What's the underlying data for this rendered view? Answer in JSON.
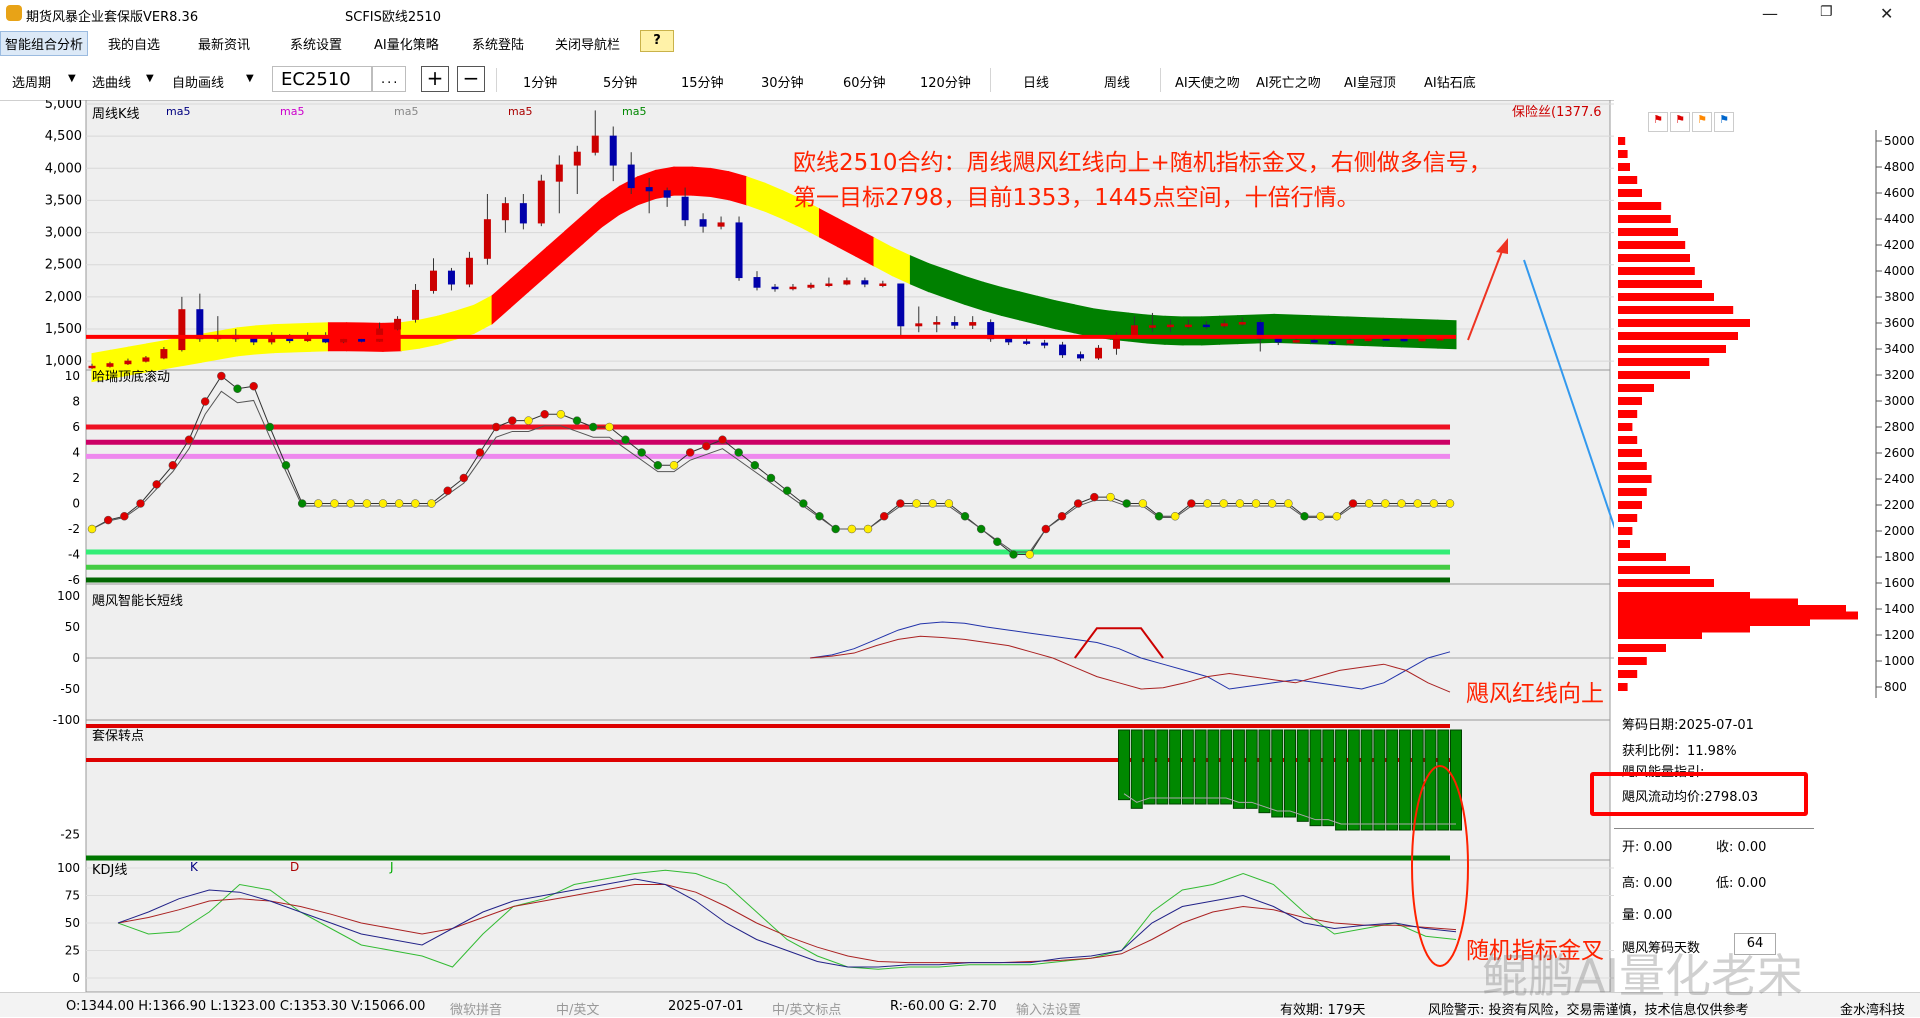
{
  "window": {
    "app_title": "期货风暴企业套保版VER8.36",
    "doc_title": "SCFIS欧线2510"
  },
  "menu": {
    "items": [
      "智能组合分析",
      "我的自选",
      "最新资讯",
      "系统设置",
      "AI量化策略",
      "系统登陆",
      "关闭导航栏"
    ],
    "help": "?"
  },
  "toolbar": {
    "period": "选周期",
    "curve": "选曲线",
    "draw": "自助画线",
    "symbol": "EC2510",
    "more": "...",
    "plus": "+",
    "minus": "−",
    "intervals": [
      "1分钟",
      "5分钟",
      "15分钟",
      "30分钟",
      "60分钟",
      "120分钟",
      "日线",
      "周线"
    ],
    "ai_buttons": [
      "AI天使之吻",
      "AI死亡之吻",
      "AI皇冠顶",
      "AI钻石底"
    ]
  },
  "panels": {
    "main_title": "周线K线",
    "ma_labels": [
      "ma5",
      "ma5",
      "ma5",
      "ma5",
      "ma5"
    ],
    "protection": "保险丝(1377.6",
    "harry_title": "哈瑞顶底滚动",
    "typhoon_title": "飓风智能长短线",
    "hedge_title": "套保转点",
    "kdj_title": "KDJ线",
    "kdj_labels": [
      "K",
      "D",
      "J"
    ]
  },
  "annotations": {
    "line1": "欧线2510合约：周线飓风红线向上+随机指标金叉，右侧做多信号，",
    "line2": "第一目标2798，目前1353，1445点空间，十倍行情。",
    "red_up": "飓风红线向上",
    "golden_cross": "随机指标金叉"
  },
  "axes": {
    "price_ticks": [
      "5,000",
      "4,500",
      "4,000",
      "3,500",
      "3,000",
      "2,500",
      "2,000",
      "1,500",
      "1,000"
    ],
    "harry_ticks": [
      "10",
      "8",
      "6",
      "4",
      "2",
      "0",
      "-2",
      "-4",
      "-6"
    ],
    "typhoon_ticks": [
      "100",
      "50",
      "0",
      "-50",
      "-100"
    ],
    "hedge_ticks": [
      "-25"
    ],
    "kdj_ticks": [
      "100",
      "75",
      "50",
      "25",
      "0"
    ],
    "profile_ticks": [
      "5000",
      "4800",
      "4600",
      "4400",
      "4200",
      "4000",
      "3800",
      "3600",
      "3400",
      "3200",
      "3000",
      "2800",
      "2600",
      "2400",
      "2200",
      "2000",
      "1800",
      "1600",
      "1400",
      "1200",
      "1000",
      "800"
    ]
  },
  "chart_data": {
    "type": "candlestick",
    "period": "周线",
    "symbol": "EC2510",
    "price_ylim": [
      800,
      5000
    ],
    "support_line": 1377.6,
    "candles": [
      {
        "o": 900,
        "c": 920,
        "h": 960,
        "l": 880
      },
      {
        "o": 920,
        "c": 960,
        "h": 990,
        "l": 900
      },
      {
        "o": 960,
        "c": 1000,
        "h": 1040,
        "l": 940
      },
      {
        "o": 1000,
        "c": 1050,
        "h": 1080,
        "l": 980
      },
      {
        "o": 1050,
        "c": 1180,
        "h": 1220,
        "l": 1030
      },
      {
        "o": 1180,
        "c": 1800,
        "h": 2000,
        "l": 1150
      },
      {
        "o": 1800,
        "c": 1350,
        "h": 2050,
        "l": 1300
      },
      {
        "o": 1350,
        "c": 1400,
        "h": 1700,
        "l": 1300
      },
      {
        "o": 1400,
        "c": 1350,
        "h": 1500,
        "l": 1300
      },
      {
        "o": 1350,
        "c": 1300,
        "h": 1400,
        "l": 1250
      },
      {
        "o": 1300,
        "c": 1350,
        "h": 1450,
        "l": 1260
      },
      {
        "o": 1350,
        "c": 1320,
        "h": 1420,
        "l": 1280
      },
      {
        "o": 1320,
        "c": 1380,
        "h": 1450,
        "l": 1300
      },
      {
        "o": 1380,
        "c": 1300,
        "h": 1450,
        "l": 1280
      },
      {
        "o": 1300,
        "c": 1340,
        "h": 1380,
        "l": 1280
      },
      {
        "o": 1340,
        "c": 1310,
        "h": 1360,
        "l": 1290
      },
      {
        "o": 1310,
        "c": 1500,
        "h": 1600,
        "l": 1300
      },
      {
        "o": 1500,
        "c": 1650,
        "h": 1700,
        "l": 1480
      },
      {
        "o": 1650,
        "c": 2100,
        "h": 2200,
        "l": 1600
      },
      {
        "o": 2100,
        "c": 2400,
        "h": 2600,
        "l": 2050
      },
      {
        "o": 2400,
        "c": 2200,
        "h": 2450,
        "l": 2100
      },
      {
        "o": 2200,
        "c": 2600,
        "h": 2700,
        "l": 2150
      },
      {
        "o": 2600,
        "c": 3200,
        "h": 3600,
        "l": 2500
      },
      {
        "o": 3200,
        "c": 3450,
        "h": 3550,
        "l": 3000
      },
      {
        "o": 3450,
        "c": 3150,
        "h": 3600,
        "l": 3050
      },
      {
        "o": 3150,
        "c": 3800,
        "h": 3900,
        "l": 3100
      },
      {
        "o": 3800,
        "c": 4050,
        "h": 4200,
        "l": 3300
      },
      {
        "o": 4050,
        "c": 4250,
        "h": 4350,
        "l": 3600
      },
      {
        "o": 4250,
        "c": 4500,
        "h": 4900,
        "l": 4200
      },
      {
        "o": 4500,
        "c": 4050,
        "h": 4650,
        "l": 3800
      },
      {
        "o": 4050,
        "c": 3700,
        "h": 4250,
        "l": 3600
      },
      {
        "o": 3700,
        "c": 3650,
        "h": 3850,
        "l": 3300
      },
      {
        "o": 3650,
        "c": 3550,
        "h": 3700,
        "l": 3400
      },
      {
        "o": 3550,
        "c": 3200,
        "h": 3700,
        "l": 3100
      },
      {
        "o": 3200,
        "c": 3100,
        "h": 3300,
        "l": 3000
      },
      {
        "o": 3100,
        "c": 3150,
        "h": 3250,
        "l": 3050
      },
      {
        "o": 3150,
        "c": 2300,
        "h": 3250,
        "l": 2250
      },
      {
        "o": 2300,
        "c": 2150,
        "h": 2400,
        "l": 2100
      },
      {
        "o": 2150,
        "c": 2130,
        "h": 2200,
        "l": 2080
      },
      {
        "o": 2130,
        "c": 2150,
        "h": 2200,
        "l": 2100
      },
      {
        "o": 2150,
        "c": 2180,
        "h": 2220,
        "l": 2120
      },
      {
        "o": 2180,
        "c": 2200,
        "h": 2300,
        "l": 2150
      },
      {
        "o": 2200,
        "c": 2250,
        "h": 2300,
        "l": 2180
      },
      {
        "o": 2250,
        "c": 2200,
        "h": 2300,
        "l": 2150
      },
      {
        "o": 2200,
        "c": 2200,
        "h": 2250,
        "l": 2150
      },
      {
        "o": 2200,
        "c": 1550,
        "h": 1800,
        "l": 1400
      },
      {
        "o": 1550,
        "c": 1580,
        "h": 1850,
        "l": 1450
      },
      {
        "o": 1580,
        "c": 1600,
        "h": 1700,
        "l": 1450
      },
      {
        "o": 1600,
        "c": 1560,
        "h": 1700,
        "l": 1500
      },
      {
        "o": 1560,
        "c": 1600,
        "h": 1700,
        "l": 1500
      },
      {
        "o": 1600,
        "c": 1350,
        "h": 1650,
        "l": 1300
      },
      {
        "o": 1350,
        "c": 1300,
        "h": 1400,
        "l": 1250
      },
      {
        "o": 1300,
        "c": 1280,
        "h": 1380,
        "l": 1250
      },
      {
        "o": 1280,
        "c": 1250,
        "h": 1330,
        "l": 1200
      },
      {
        "o": 1250,
        "c": 1100,
        "h": 1300,
        "l": 1050
      },
      {
        "o": 1100,
        "c": 1050,
        "h": 1150,
        "l": 1000
      },
      {
        "o": 1050,
        "c": 1200,
        "h": 1250,
        "l": 1020
      },
      {
        "o": 1200,
        "c": 1400,
        "h": 1450,
        "l": 1100
      },
      {
        "o": 1400,
        "c": 1550,
        "h": 1700,
        "l": 1350
      },
      {
        "o": 1550,
        "c": 1550,
        "h": 1750,
        "l": 1450
      },
      {
        "o": 1550,
        "c": 1560,
        "h": 1650,
        "l": 1450
      },
      {
        "o": 1560,
        "c": 1560,
        "h": 1650,
        "l": 1500
      },
      {
        "o": 1560,
        "c": 1550,
        "h": 1620,
        "l": 1500
      },
      {
        "o": 1550,
        "c": 1580,
        "h": 1650,
        "l": 1520
      },
      {
        "o": 1580,
        "c": 1600,
        "h": 1680,
        "l": 1550
      },
      {
        "o": 1600,
        "c": 1350,
        "h": 1650,
        "l": 1150
      },
      {
        "o": 1350,
        "c": 1300,
        "h": 1380,
        "l": 1250
      },
      {
        "o": 1300,
        "c": 1320,
        "h": 1350,
        "l": 1280
      },
      {
        "o": 1320,
        "c": 1300,
        "h": 1350,
        "l": 1280
      },
      {
        "o": 1300,
        "c": 1280,
        "h": 1330,
        "l": 1250
      },
      {
        "o": 1280,
        "c": 1320,
        "h": 1360,
        "l": 1270
      },
      {
        "o": 1320,
        "c": 1350,
        "h": 1380,
        "l": 1300
      },
      {
        "o": 1350,
        "c": 1340,
        "h": 1400,
        "l": 1320
      },
      {
        "o": 1340,
        "c": 1330,
        "h": 1380,
        "l": 1300
      },
      {
        "o": 1330,
        "c": 1340,
        "h": 1370,
        "l": 1300
      },
      {
        "o": 1340,
        "c": 1353,
        "h": 1367,
        "l": 1323
      }
    ],
    "ribbon": [
      {
        "v": 900,
        "c": "#ffff00"
      },
      {
        "v": 950,
        "c": "#ffff00"
      },
      {
        "v": 1000,
        "c": "#ffff00"
      },
      {
        "v": 1050,
        "c": "#ffff00"
      },
      {
        "v": 1100,
        "c": "#ffff00"
      },
      {
        "v": 1150,
        "c": "#ffff00"
      },
      {
        "v": 1200,
        "c": "#ffff00"
      },
      {
        "v": 1250,
        "c": "#ffff00"
      },
      {
        "v": 1300,
        "c": "#ffff00"
      },
      {
        "v": 1330,
        "c": "#ffff00"
      },
      {
        "v": 1350,
        "c": "#ffff00"
      },
      {
        "v": 1360,
        "c": "#ffff00"
      },
      {
        "v": 1370,
        "c": "#ffff00"
      },
      {
        "v": 1380,
        "c": "#ff0000"
      },
      {
        "v": 1380,
        "c": "#ff0000"
      },
      {
        "v": 1375,
        "c": "#ff0000"
      },
      {
        "v": 1370,
        "c": "#ff0000"
      },
      {
        "v": 1380,
        "c": "#ffff00"
      },
      {
        "v": 1420,
        "c": "#ffff00"
      },
      {
        "v": 1480,
        "c": "#ffff00"
      },
      {
        "v": 1560,
        "c": "#ffff00"
      },
      {
        "v": 1650,
        "c": "#ffff00"
      },
      {
        "v": 1800,
        "c": "#ff0000"
      },
      {
        "v": 2050,
        "c": "#ff0000"
      },
      {
        "v": 2300,
        "c": "#ff0000"
      },
      {
        "v": 2550,
        "c": "#ff0000"
      },
      {
        "v": 2800,
        "c": "#ff0000"
      },
      {
        "v": 3050,
        "c": "#ff0000"
      },
      {
        "v": 3300,
        "c": "#ff0000"
      },
      {
        "v": 3500,
        "c": "#ff0000"
      },
      {
        "v": 3650,
        "c": "#ff0000"
      },
      {
        "v": 3750,
        "c": "#ff0000"
      },
      {
        "v": 3800,
        "c": "#ff0000"
      },
      {
        "v": 3800,
        "c": "#ff0000"
      },
      {
        "v": 3780,
        "c": "#ff0000"
      },
      {
        "v": 3730,
        "c": "#ff0000"
      },
      {
        "v": 3650,
        "c": "#ffff00"
      },
      {
        "v": 3550,
        "c": "#ffff00"
      },
      {
        "v": 3430,
        "c": "#ffff00"
      },
      {
        "v": 3300,
        "c": "#ffff00"
      },
      {
        "v": 3150,
        "c": "#ff0000"
      },
      {
        "v": 3000,
        "c": "#ff0000"
      },
      {
        "v": 2850,
        "c": "#ff0000"
      },
      {
        "v": 2700,
        "c": "#ffff00"
      },
      {
        "v": 2550,
        "c": "#ffff00"
      },
      {
        "v": 2420,
        "c": "#008000"
      },
      {
        "v": 2300,
        "c": "#008000"
      },
      {
        "v": 2200,
        "c": "#008000"
      },
      {
        "v": 2100,
        "c": "#008000"
      },
      {
        "v": 2010,
        "c": "#008000"
      },
      {
        "v": 1930,
        "c": "#008000"
      },
      {
        "v": 1860,
        "c": "#008000"
      },
      {
        "v": 1790,
        "c": "#008000"
      },
      {
        "v": 1720,
        "c": "#008000"
      },
      {
        "v": 1660,
        "c": "#008000"
      },
      {
        "v": 1600,
        "c": "#008000"
      },
      {
        "v": 1560,
        "c": "#008000"
      },
      {
        "v": 1530,
        "c": "#008000"
      },
      {
        "v": 1500,
        "c": "#008000"
      },
      {
        "v": 1480,
        "c": "#008000"
      },
      {
        "v": 1470,
        "c": "#008000"
      },
      {
        "v": 1470,
        "c": "#008000"
      },
      {
        "v": 1480,
        "c": "#008000"
      },
      {
        "v": 1490,
        "c": "#008000"
      },
      {
        "v": 1500,
        "c": "#008000"
      },
      {
        "v": 1510,
        "c": "#008000"
      },
      {
        "v": 1500,
        "c": "#008000"
      },
      {
        "v": 1490,
        "c": "#008000"
      },
      {
        "v": 1480,
        "c": "#008000"
      },
      {
        "v": 1470,
        "c": "#008000"
      },
      {
        "v": 1460,
        "c": "#008000"
      },
      {
        "v": 1450,
        "c": "#008000"
      },
      {
        "v": 1440,
        "c": "#008000"
      },
      {
        "v": 1430,
        "c": "#008000"
      },
      {
        "v": 1420,
        "c": "#008000"
      },
      {
        "v": 1410,
        "c": "#008000"
      }
    ],
    "harry": [
      -2,
      -1.3,
      -1,
      0,
      1.5,
      3,
      5,
      8,
      10,
      9,
      9.2,
      6,
      3,
      0,
      0,
      0,
      0,
      0,
      0,
      0,
      0,
      0,
      1,
      2,
      4,
      6,
      6.5,
      6.5,
      7,
      7,
      6.5,
      6,
      6,
      5,
      4,
      3,
      3,
      4,
      4.5,
      5,
      4,
      3,
      2,
      1,
      0,
      -1,
      -2,
      -2,
      -2,
      -1,
      0,
      0,
      0,
      0,
      -1,
      -2,
      -3,
      -4,
      -4,
      -2,
      -1,
      0,
      0.5,
      0.5,
      0,
      0,
      -1,
      -1,
      0,
      0,
      0,
      0,
      0,
      0,
      0,
      -1,
      -1,
      -1,
      0,
      0,
      0,
      0,
      0,
      0,
      0
    ],
    "typhoon_blue": [
      0,
      5,
      15,
      30,
      45,
      55,
      58,
      56,
      50,
      45,
      40,
      35,
      30,
      25,
      15,
      0,
      -10,
      -20,
      -30,
      -50,
      -45,
      -40,
      -35,
      -40,
      -45,
      -50,
      -40,
      -20,
      0,
      10
    ],
    "typhoon_red": [
      0,
      3,
      8,
      20,
      30,
      35,
      33,
      30,
      25,
      20,
      10,
      0,
      -15,
      -30,
      -40,
      -50,
      -48,
      -40,
      -30,
      -25,
      -30,
      -35,
      -40,
      -30,
      -20,
      -15,
      -10,
      -20,
      -40,
      -55
    ],
    "hedge_bars": [
      -17,
      -19,
      -18,
      -18,
      -18,
      -18,
      -18,
      -18,
      -18,
      -19,
      -19,
      -20,
      -21,
      -21,
      -22,
      -23,
      -23,
      -24,
      -24,
      -24,
      -24,
      -24,
      -24,
      -24,
      -24,
      -24,
      -24
    ],
    "kdj_K": [
      50,
      60,
      72,
      80,
      78,
      70,
      60,
      50,
      40,
      35,
      30,
      45,
      60,
      70,
      75,
      80,
      85,
      90,
      85,
      70,
      50,
      35,
      25,
      15,
      10,
      10,
      12,
      12,
      14,
      14,
      14,
      18,
      20,
      25,
      50,
      65,
      70,
      75,
      65,
      50,
      45,
      48,
      50,
      45,
      42
    ],
    "kdj_D": [
      50,
      55,
      62,
      70,
      72,
      70,
      65,
      58,
      50,
      45,
      40,
      45,
      55,
      65,
      70,
      75,
      80,
      85,
      85,
      78,
      65,
      50,
      38,
      28,
      20,
      15,
      14,
      14,
      14,
      14,
      15,
      16,
      18,
      22,
      35,
      50,
      60,
      65,
      62,
      55,
      50,
      48,
      48,
      46,
      44
    ],
    "kdj_J": [
      50,
      40,
      42,
      60,
      85,
      80,
      60,
      45,
      30,
      25,
      20,
      10,
      40,
      65,
      72,
      85,
      90,
      95,
      98,
      95,
      85,
      60,
      35,
      20,
      10,
      8,
      10,
      10,
      12,
      12,
      12,
      15,
      18,
      25,
      60,
      80,
      85,
      95,
      85,
      60,
      40,
      45,
      50,
      38,
      35
    ],
    "volume_profile": [
      [
        5000,
        3
      ],
      [
        4900,
        4
      ],
      [
        4800,
        5
      ],
      [
        4700,
        8
      ],
      [
        4600,
        10
      ],
      [
        4500,
        18
      ],
      [
        4400,
        22
      ],
      [
        4300,
        25
      ],
      [
        4200,
        28
      ],
      [
        4100,
        30
      ],
      [
        4000,
        32
      ],
      [
        3900,
        35
      ],
      [
        3800,
        40
      ],
      [
        3700,
        48
      ],
      [
        3600,
        55
      ],
      [
        3500,
        50
      ],
      [
        3400,
        45
      ],
      [
        3300,
        38
      ],
      [
        3200,
        30
      ],
      [
        3100,
        15
      ],
      [
        3000,
        10
      ],
      [
        2900,
        8
      ],
      [
        2800,
        6
      ],
      [
        2700,
        8
      ],
      [
        2600,
        10
      ],
      [
        2500,
        12
      ],
      [
        2400,
        14
      ],
      [
        2300,
        12
      ],
      [
        2200,
        10
      ],
      [
        2100,
        8
      ],
      [
        2000,
        6
      ],
      [
        1900,
        5
      ],
      [
        1800,
        20
      ],
      [
        1700,
        30
      ],
      [
        1600,
        40
      ],
      [
        1500,
        55
      ],
      [
        1450,
        75
      ],
      [
        1400,
        95
      ],
      [
        1350,
        100
      ],
      [
        1300,
        80
      ],
      [
        1250,
        55
      ],
      [
        1200,
        35
      ],
      [
        1100,
        20
      ],
      [
        1000,
        12
      ],
      [
        900,
        8
      ],
      [
        800,
        4
      ]
    ]
  },
  "right_panel": {
    "chip_date": "筹码日期:2025-07-01",
    "profit_ratio": "获利比例：11.98%",
    "energy": "飓风能量指引:",
    "avg_price": "飓风流动均价:2798.03",
    "open": "开:  0.00",
    "close": "收:  0.00",
    "high": "高:  0.00",
    "low": "低:  0.00",
    "volume": "量:  0.00",
    "chip_days_label": "飓风筹码天数",
    "chip_days_value": "64"
  },
  "status": {
    "ohlc": "O:1344.00  H:1366.90  L:1323.00  C:1353.30  V:15066.00",
    "ime1": "微软拼音",
    "ime2": "中/英文",
    "date": "2025-07-01",
    "ime3": "中/英文标点",
    "rg": "R:-60.00  G:  2.70",
    "ime4": "输入法设置",
    "validity": "有效期:  179天",
    "risk": "风险警示:  投资有风险，交易需谨慎，技术信息仅供参考",
    "company": "金水湾科技",
    "watermark": "鲲鹏AI量化老宋"
  },
  "colors": {
    "up": "#cc0000",
    "down": "#0000aa",
    "annotation": "#ff2200",
    "blue_arrow": "#2299ee",
    "highlight_box": "#ff0000",
    "green": "#008000"
  }
}
